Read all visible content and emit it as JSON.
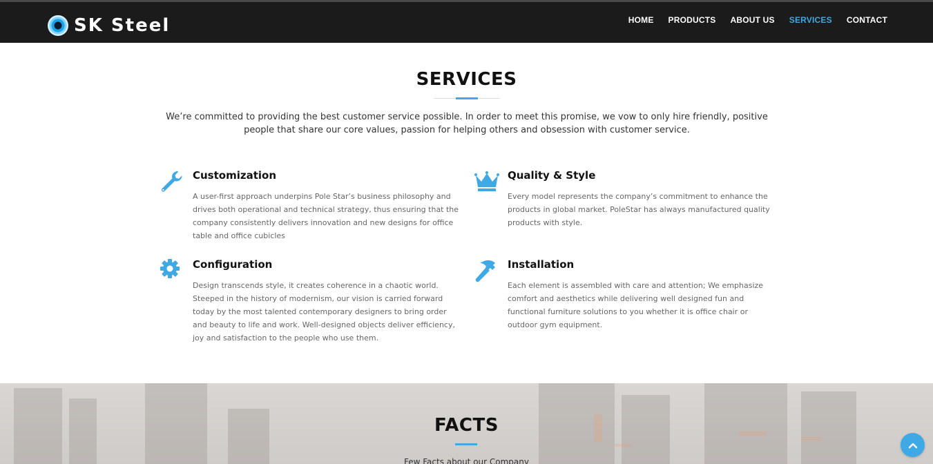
{
  "header": {
    "brand": "SK Steel",
    "nav": [
      {
        "label": "HOME"
      },
      {
        "label": "PRODUCTS"
      },
      {
        "label": "ABOUT US"
      },
      {
        "label": "SERVICES",
        "active": true
      },
      {
        "label": "CONTACT"
      }
    ]
  },
  "services": {
    "title": "SERVICES",
    "intro": "We’re committed to providing the best customer service possible. In order to meet this promise, we vow to only hire friendly, positive people that share our core values, passion for helping others and obsession with customer service.",
    "items": [
      {
        "icon": "wrench-icon",
        "title": "Customization",
        "text": "A user-first approach underpins Pole Star’s business philosophy and drives both operational and technical strategy, thus ensuring that the company consistently delivers innovation and new designs for office table and office cubicles"
      },
      {
        "icon": "crown-icon",
        "title": "Quality & Style",
        "text": "Every model represents the company’s commitment to enhance the products in global market. PoleStar has always manufactured quality products with style."
      },
      {
        "icon": "gear-icon",
        "title": "Configuration",
        "text": "Design transcends style, it creates coherence in a chaotic world. Steeped in the history of modernism, our vision is carried forward today by the most talented contemporary designers to bring order and beauty to life and work. Well-designed objects deliver efficiency, joy and satisfaction to the people who use them."
      },
      {
        "icon": "hammer-icon",
        "title": "Installation",
        "text": "Each element is assembled with care and attention; We emphasize comfort and aesthetics while delivering well designed fun and functional furniture solutions to you whether it is office chair or outdoor gym equipment."
      }
    ]
  },
  "facts": {
    "title": "FACTS",
    "subtitle": "Few Facts about our Company"
  },
  "colors": {
    "accent": "#3fa9e5",
    "header_bg": "#1b1b1b"
  }
}
